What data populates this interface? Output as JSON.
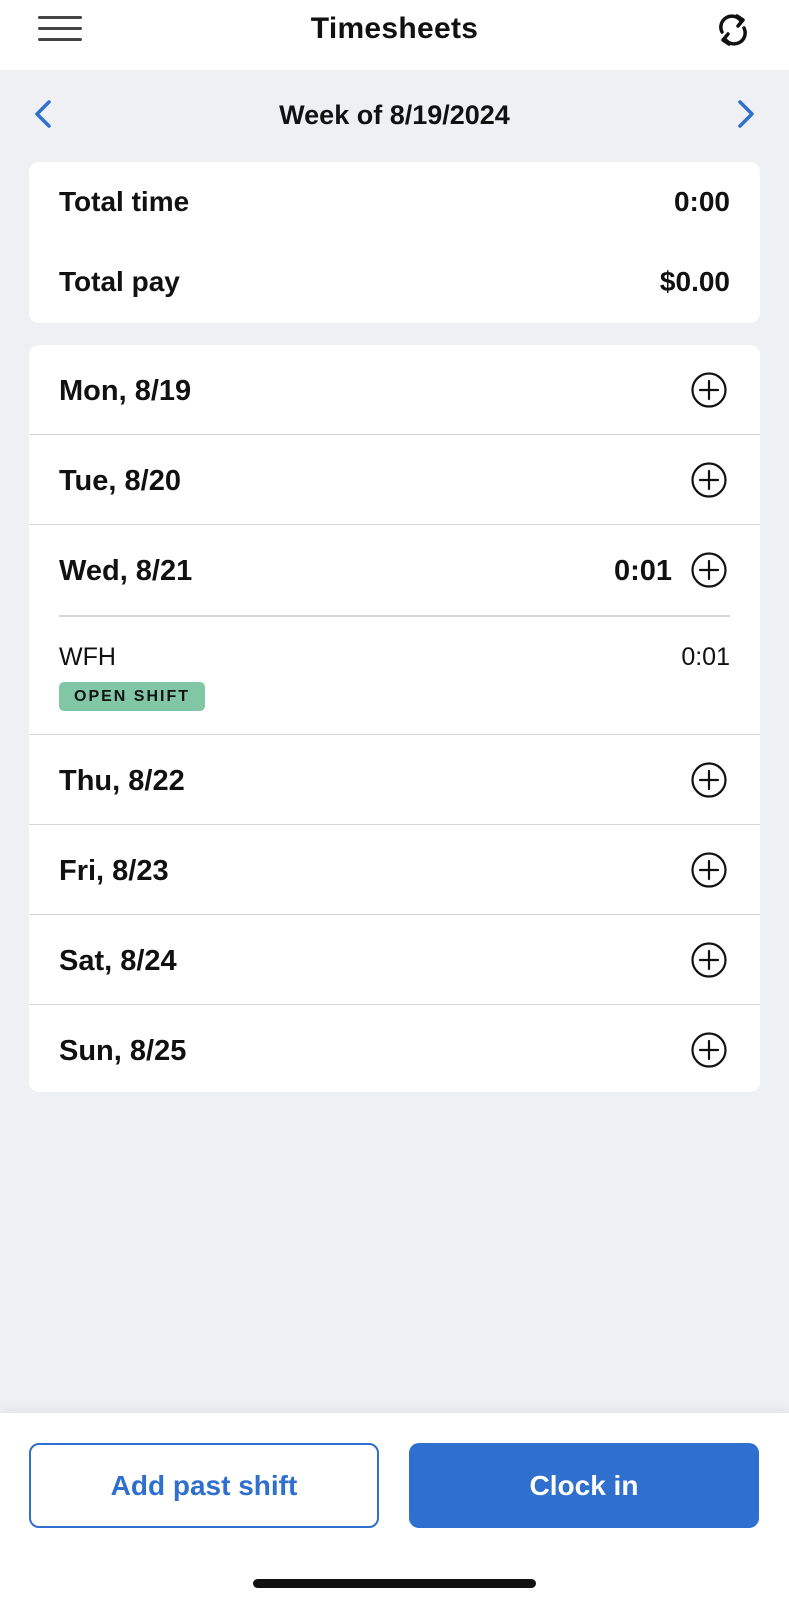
{
  "header": {
    "title": "Timesheets"
  },
  "week": {
    "label": "Week of 8/19/2024"
  },
  "totals": {
    "time_label": "Total time",
    "time_value": "0:00",
    "pay_label": "Total pay",
    "pay_value": "$0.00"
  },
  "days": [
    {
      "label": "Mon, 8/19"
    },
    {
      "label": "Tue, 8/20"
    },
    {
      "label": "Wed, 8/21",
      "total": "0:01",
      "shift": {
        "name": "WFH",
        "time": "0:01",
        "badge": "OPEN SHIFT"
      }
    },
    {
      "label": "Thu, 8/22"
    },
    {
      "label": "Fri, 8/23"
    },
    {
      "label": "Sat, 8/24"
    },
    {
      "label": "Sun, 8/25"
    }
  ],
  "footer": {
    "add_past_shift": "Add past shift",
    "clock_in": "Clock in"
  },
  "colors": {
    "accent": "#2f6fce",
    "badge": "#82c7a5",
    "background": "#eef0f4"
  },
  "icons": {
    "menu": "hamburger-icon",
    "refresh": "refresh-icon",
    "prev": "chevron-left-icon",
    "next": "chevron-right-icon",
    "add": "plus-circle-icon"
  }
}
